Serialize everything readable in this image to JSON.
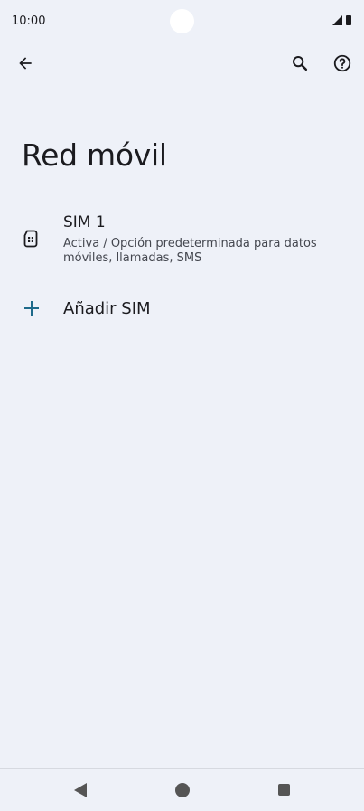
{
  "status_bar": {
    "time": "10:00"
  },
  "toolbar": {
    "back_icon": "arrow-left-icon",
    "search_icon": "search-icon",
    "help_icon": "help-circle-icon"
  },
  "page": {
    "title": "Red móvil"
  },
  "sim": {
    "icon": "sim-card-icon",
    "title": "SIM 1",
    "summary": "Activa / Opción predeterminada para datos móviles, llamadas, SMS"
  },
  "add_sim": {
    "icon": "plus-icon",
    "label": "Añadir SIM",
    "accent_color": "#1e6a8a"
  },
  "nav_bar": {
    "back_icon": "nav-back-icon",
    "home_icon": "nav-home-icon",
    "recents_icon": "nav-recents-icon"
  },
  "colors": {
    "background": "#eef1f8",
    "text_primary": "#1b1b1f",
    "text_secondary": "#44474f",
    "nav_icons": "#555555"
  }
}
